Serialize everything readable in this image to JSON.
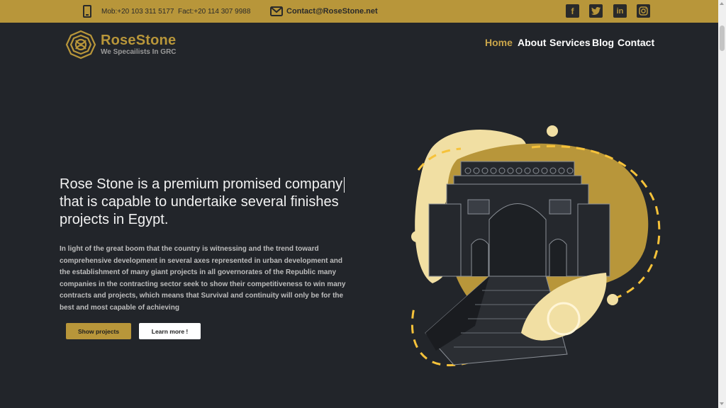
{
  "topbar": {
    "mobile": "Mob:+20 103 311 5177",
    "fax": "Fact:+20 114 307 9988",
    "email": "Contact@RoseStone.net",
    "social_icons": [
      "facebook-icon",
      "twitter-icon",
      "linkedin-icon",
      "instagram-icon"
    ]
  },
  "brand": {
    "name": "RoseStone",
    "tagline": "We Specailists In GRC"
  },
  "nav": {
    "items": [
      {
        "label": "Home",
        "active": true
      },
      {
        "label": "About",
        "active": false
      },
      {
        "label": "Services",
        "active": false
      },
      {
        "label": "Blog",
        "active": false
      },
      {
        "label": "Contact",
        "active": false
      }
    ]
  },
  "hero": {
    "headline": "Rose Stone is a premium promised company that is capable to undertaike several finishes projects in Egypt.",
    "paragraph": "In light of the great boom that the country is witnessing and the trend toward comprehensive development in several axes represented in urban development and the establishment of many giant projects in all governorates of the Republic many companies in the contracting sector seek to show their competitiveness to win many contracts and projects, which means that Survival and continuity will only be for the best and most capable of achieving",
    "primary_button": "Show projects",
    "secondary_button": "Learn more !"
  },
  "colors": {
    "brand_gold": "#b8963a",
    "background": "#22252a",
    "nav_active": "#c9a54a",
    "cream": "#f1dfa3",
    "accent_yellow": "#f6c23a"
  }
}
